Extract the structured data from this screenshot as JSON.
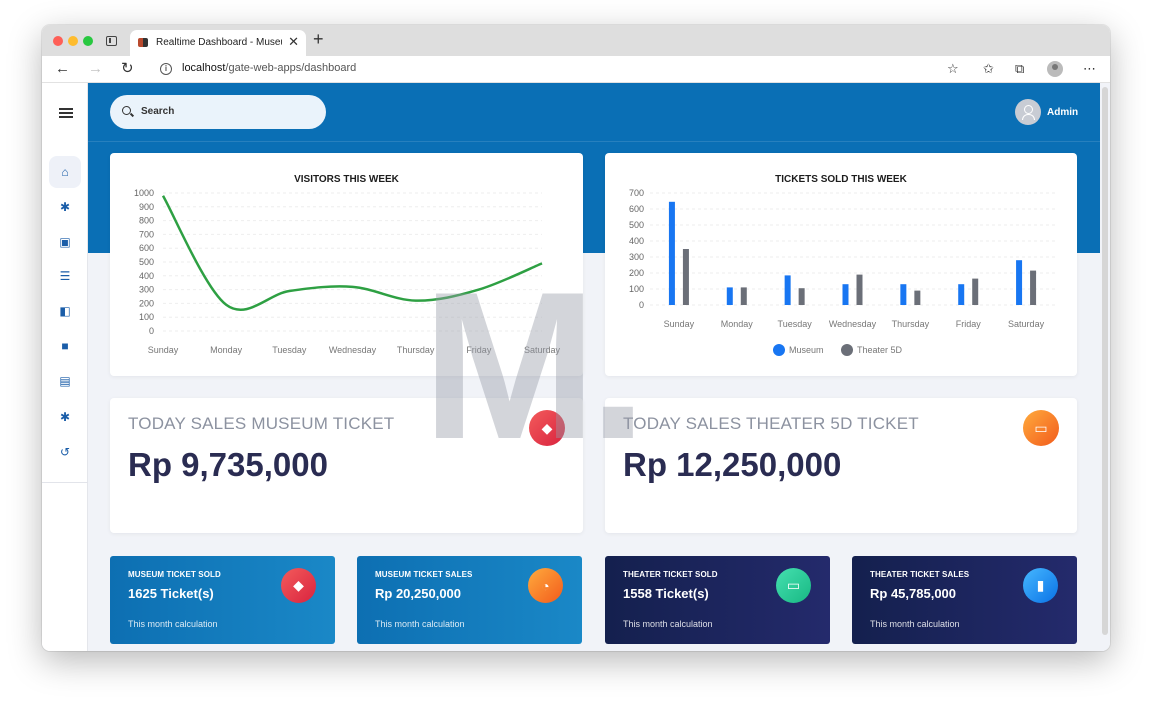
{
  "browser": {
    "tab_title": "Realtime Dashboard - Museum",
    "close_glyph": "✕",
    "new_tab_glyph": "+",
    "url_host": "localhost",
    "url_path": "/gate-web-apps/dashboard",
    "back_glyph": "←",
    "forward_glyph": "→",
    "reload_glyph": "↻",
    "info_glyph": "i",
    "star_add_glyph": "☆",
    "favorites_glyph": "✩",
    "collections_glyph": "⧉",
    "more_glyph": "⋯"
  },
  "header": {
    "search_placeholder": "Search",
    "user_name": "Admin"
  },
  "sidebar": {
    "items": [
      {
        "icon": "museum-icon",
        "glyph": "⌂"
      },
      {
        "icon": "gear-icon",
        "glyph": "✱"
      },
      {
        "icon": "id-card-icon",
        "glyph": "▣"
      },
      {
        "icon": "checklist-icon",
        "glyph": "☰"
      },
      {
        "icon": "unlock-icon",
        "glyph": "◧"
      },
      {
        "icon": "lock-icon",
        "glyph": "■"
      },
      {
        "icon": "gallery-icon",
        "glyph": "▤"
      },
      {
        "icon": "settings-icon",
        "glyph": "✱"
      },
      {
        "icon": "history-icon",
        "glyph": "↺"
      }
    ]
  },
  "sales": {
    "museum": {
      "title": "TODAY SALES MUSEUM TICKET",
      "value": "Rp 9,735,000",
      "icon": "tag-icon",
      "glyph": "◆"
    },
    "theater": {
      "title": "TODAY SALES THEATER 5D TICKET",
      "value": "Rp 12,250,000",
      "icon": "monitor-icon",
      "glyph": "▭"
    }
  },
  "stats": [
    {
      "label": "MUSEUM TICKET SOLD",
      "value": "1625 Ticket(s)",
      "sub": "This month calculation",
      "icon": "tag-icon",
      "glyph": "◆"
    },
    {
      "label": "MUSEUM TICKET SALES",
      "value": "Rp 20,250,000",
      "sub": "This month calculation",
      "icon": "pie-chart-icon",
      "glyph": "◔"
    },
    {
      "label": "THEATER TICKET SOLD",
      "value": "1558 Ticket(s)",
      "sub": "This month calculation",
      "icon": "monitor-icon",
      "glyph": "▭"
    },
    {
      "label": "THEATER TICKET SALES",
      "value": "Rp 45,785,000",
      "sub": "This month calculation",
      "icon": "bar-chart-icon",
      "glyph": "▮"
    }
  ],
  "watermark": "M.",
  "colors": {
    "header_blue": "#0a6fb5",
    "line_green": "#2ea043",
    "museum_bar": "#1876f2",
    "theater_bar": "#6b6f78",
    "value_navy": "#2a2c52"
  },
  "chart_data": [
    {
      "type": "line",
      "title": "VISITORS THIS WEEK",
      "categories": [
        "Sunday",
        "Monday",
        "Tuesday",
        "Wednesday",
        "Thursday",
        "Friday",
        "Saturday"
      ],
      "series": [
        {
          "values": [
            980,
            190,
            290,
            320,
            220,
            300,
            490
          ]
        }
      ],
      "ylim": [
        0,
        1000
      ],
      "yticks": [
        0,
        100,
        200,
        300,
        400,
        500,
        600,
        700,
        800,
        900,
        1000
      ],
      "grid": true
    },
    {
      "type": "bar",
      "title": "TICKETS SOLD THIS WEEK",
      "categories": [
        "Sunday",
        "Monday",
        "Tuesday",
        "Wednesday",
        "Thursday",
        "Friday",
        "Saturday"
      ],
      "series": [
        {
          "name": "Museum",
          "values": [
            645,
            110,
            185,
            130,
            130,
            130,
            280
          ]
        },
        {
          "name": "Theater 5D",
          "values": [
            350,
            110,
            105,
            190,
            90,
            165,
            215
          ]
        }
      ],
      "ylim": [
        0,
        700
      ],
      "yticks": [
        0,
        100,
        200,
        300,
        400,
        500,
        600,
        700
      ],
      "grid": true,
      "legend": "bottom"
    }
  ]
}
